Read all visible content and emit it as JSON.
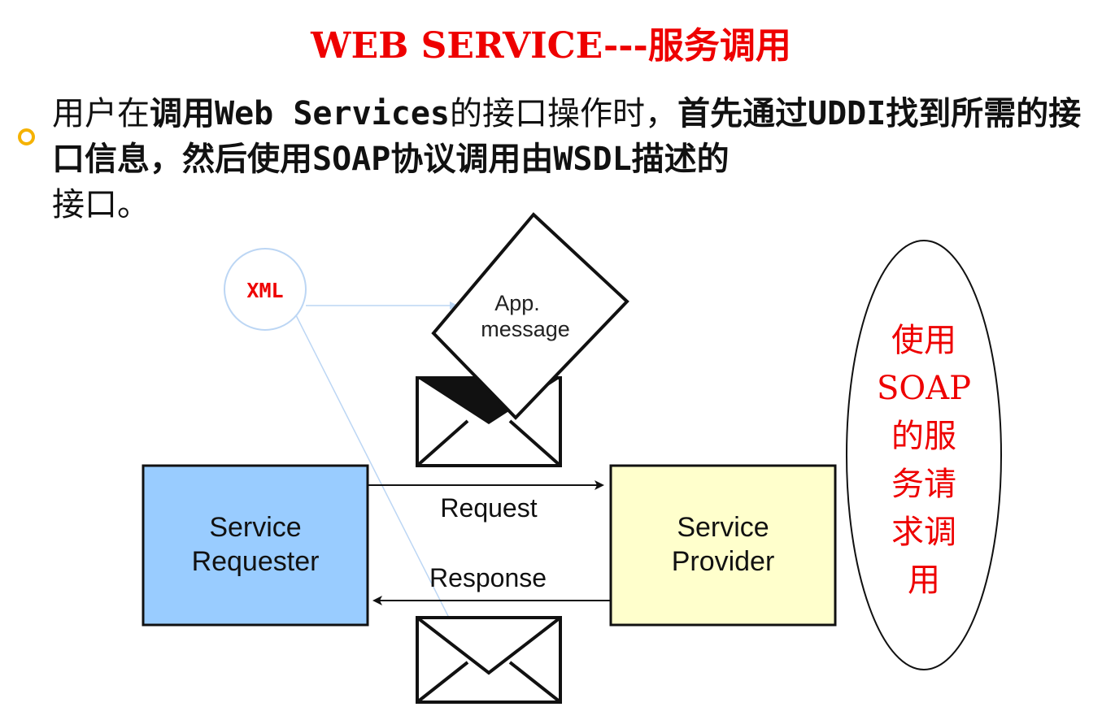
{
  "title": "WEB SERVICE---服务调用",
  "bullet": {
    "parts": [
      {
        "text": "用户在",
        "bold": false
      },
      {
        "text": "调用Web Services",
        "bold": true
      },
      {
        "text": "的接口操作时，",
        "bold": false
      },
      {
        "text": "首先通过UDDI找到所需的接口信息，然后使用SOAP协议调用由WSDL描述的",
        "bold": true
      },
      {
        "text": "接口。",
        "bold": false
      }
    ]
  },
  "diagram": {
    "xml_bubble": "XML",
    "app_message": [
      "App.",
      "message"
    ],
    "requester": [
      "Service",
      "Requester"
    ],
    "provider": [
      "Service",
      "Provider"
    ],
    "request_label": "Request",
    "response_label": "Response",
    "side_note": [
      "使用",
      "SOAP",
      "的服",
      "务请",
      "求调",
      "用"
    ],
    "colors": {
      "title": "#ee0000",
      "bullet": "#f5b200",
      "requester_fill": "#99ccff",
      "provider_fill": "#ffffcc",
      "xml_line": "#bcd6f4",
      "side_note": "#ee0000"
    }
  }
}
